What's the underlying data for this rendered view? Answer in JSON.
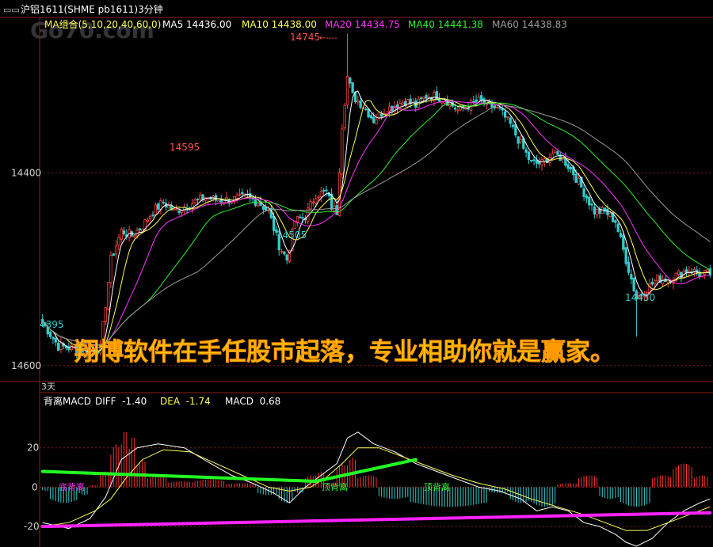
{
  "window": {
    "title": "沪铝1611(SHME pb1611)3分钟",
    "watermark": "Go70.com"
  },
  "colors": {
    "up": "#ff4040",
    "down": "#33cccc",
    "ma5": "#ffffff",
    "ma10": "#ffff55",
    "ma20": "#ff33ff",
    "ma40": "#33ee33",
    "ma60": "#9a9a9a",
    "grid": "#8a1c1c",
    "macd_pos": "#ff3030",
    "macd_neg": "#33cccc",
    "trend_green": "#22ff22",
    "trend_magenta": "#ff22ff",
    "banner": "#ffee00"
  },
  "ma_legend": {
    "group": "MA组合(5,10,20,40,60,0)",
    "ma5": "MA5 14436.00",
    "ma10": "MA10 14438.00",
    "ma20": "MA20 14434.75",
    "ma40": "MA40 14441.38",
    "ma60": "MA60 14438.83"
  },
  "price_axis": {
    "ticks": [
      "14600",
      "14400"
    ]
  },
  "annotations": {
    "high": "14745",
    "peak1": "14595",
    "low1": "14505",
    "low2": "14430",
    "low0": "4395",
    "day_label": "3天"
  },
  "banner": "翔博软件在手任股市起落，专业相助你就是赢家。",
  "macd_legend": {
    "name": "背离MACD",
    "diff": "DIFF  -1.40",
    "dea": "DEA  -1.74",
    "macd": "MACD  0.68"
  },
  "macd_axis": {
    "ticks": [
      "20",
      "0",
      "-20"
    ]
  },
  "macd_labels": {
    "bottom_div": "底背离",
    "top_div1": "顶背离",
    "top_div2": "顶背离"
  },
  "chart_data": [
    {
      "type": "candlestick",
      "title": "沪铝1611(SHME pb1611)3分钟",
      "ylim": [
        14385,
        14760
      ],
      "y_ticks": [
        14400,
        14600
      ],
      "close_path": [
        [
          0,
          14445
        ],
        [
          6,
          14420
        ],
        [
          12,
          14418
        ],
        [
          18,
          14415
        ],
        [
          22,
          14418
        ],
        [
          26,
          14510
        ],
        [
          30,
          14540
        ],
        [
          34,
          14535
        ],
        [
          38,
          14545
        ],
        [
          42,
          14560
        ],
        [
          46,
          14570
        ],
        [
          50,
          14560
        ],
        [
          54,
          14565
        ],
        [
          58,
          14570
        ],
        [
          62,
          14575
        ],
        [
          66,
          14572
        ],
        [
          70,
          14572
        ],
        [
          74,
          14573
        ],
        [
          78,
          14575
        ],
        [
          82,
          14570
        ],
        [
          86,
          14560
        ],
        [
          90,
          14525
        ],
        [
          93,
          14510
        ],
        [
          96,
          14550
        ],
        [
          100,
          14555
        ],
        [
          104,
          14578
        ],
        [
          108,
          14580
        ],
        [
          110,
          14565
        ],
        [
          112,
          14560
        ],
        [
          114,
          14650
        ],
        [
          116,
          14700
        ],
        [
          118,
          14680
        ],
        [
          122,
          14670
        ],
        [
          126,
          14655
        ],
        [
          130,
          14665
        ],
        [
          134,
          14670
        ],
        [
          138,
          14675
        ],
        [
          142,
          14670
        ],
        [
          146,
          14680
        ],
        [
          150,
          14680
        ],
        [
          154,
          14675
        ],
        [
          158,
          14665
        ],
        [
          162,
          14670
        ],
        [
          166,
          14675
        ],
        [
          170,
          14670
        ],
        [
          174,
          14665
        ],
        [
          178,
          14650
        ],
        [
          182,
          14630
        ],
        [
          186,
          14610
        ],
        [
          190,
          14610
        ],
        [
          194,
          14620
        ],
        [
          198,
          14615
        ],
        [
          202,
          14600
        ],
        [
          206,
          14580
        ],
        [
          210,
          14560
        ],
        [
          214,
          14560
        ],
        [
          218,
          14550
        ],
        [
          222,
          14510
        ],
        [
          226,
          14470
        ],
        [
          230,
          14480
        ],
        [
          234,
          14490
        ],
        [
          238,
          14490
        ],
        [
          242,
          14495
        ],
        [
          246,
          14500
        ],
        [
          250,
          14495
        ],
        [
          254,
          14495
        ]
      ],
      "ma_lines": [
        "MA5",
        "MA10",
        "MA20",
        "MA40",
        "MA60"
      ]
    },
    {
      "type": "bar",
      "title": "背离MACD",
      "ylim": [
        -30,
        40
      ],
      "y_ticks": [
        20,
        0,
        -20
      ],
      "histogram": [
        {
          "from": 0,
          "to": 3,
          "value": -2
        },
        {
          "from": 3,
          "to": 14,
          "value": -8
        },
        {
          "from": 14,
          "to": 18,
          "value": -4
        },
        {
          "from": 18,
          "to": 22,
          "value": 1
        },
        {
          "from": 22,
          "to": 26,
          "value": 8
        },
        {
          "from": 26,
          "to": 30,
          "value": 22
        },
        {
          "from": 30,
          "to": 33,
          "value": 29
        },
        {
          "from": 33,
          "to": 36,
          "value": 26
        },
        {
          "from": 36,
          "to": 40,
          "value": 14
        },
        {
          "from": 40,
          "to": 48,
          "value": 6
        },
        {
          "from": 48,
          "to": 58,
          "value": 3
        },
        {
          "from": 58,
          "to": 70,
          "value": 4
        },
        {
          "from": 70,
          "to": 82,
          "value": 2
        },
        {
          "from": 82,
          "to": 90,
          "value": -4
        },
        {
          "from": 90,
          "to": 96,
          "value": -8
        },
        {
          "from": 96,
          "to": 100,
          "value": -3
        },
        {
          "from": 100,
          "to": 104,
          "value": 6
        },
        {
          "from": 104,
          "to": 108,
          "value": 8
        },
        {
          "from": 108,
          "to": 112,
          "value": 2
        },
        {
          "from": 112,
          "to": 116,
          "value": 12
        },
        {
          "from": 116,
          "to": 120,
          "value": 15
        },
        {
          "from": 120,
          "to": 128,
          "value": 6
        },
        {
          "from": 128,
          "to": 140,
          "value": -6
        },
        {
          "from": 140,
          "to": 170,
          "value": -10
        },
        {
          "from": 170,
          "to": 178,
          "value": -3
        },
        {
          "from": 178,
          "to": 186,
          "value": -8
        },
        {
          "from": 186,
          "to": 196,
          "value": -10
        },
        {
          "from": 196,
          "to": 204,
          "value": 2
        },
        {
          "from": 204,
          "to": 212,
          "value": 6
        },
        {
          "from": 212,
          "to": 220,
          "value": -6
        },
        {
          "from": 220,
          "to": 232,
          "value": -10
        },
        {
          "from": 232,
          "to": 240,
          "value": 6
        },
        {
          "from": 240,
          "to": 248,
          "value": 12
        },
        {
          "from": 248,
          "to": 254,
          "value": 6
        }
      ],
      "diff_path": [
        [
          0,
          -18
        ],
        [
          10,
          -21
        ],
        [
          18,
          -16
        ],
        [
          24,
          -5
        ],
        [
          30,
          14
        ],
        [
          36,
          20
        ],
        [
          44,
          22
        ],
        [
          54,
          20
        ],
        [
          64,
          12
        ],
        [
          72,
          6
        ],
        [
          80,
          2
        ],
        [
          88,
          -3
        ],
        [
          94,
          -8
        ],
        [
          100,
          0
        ],
        [
          106,
          6
        ],
        [
          112,
          12
        ],
        [
          116,
          25
        ],
        [
          120,
          28
        ],
        [
          126,
          22
        ],
        [
          134,
          18
        ],
        [
          142,
          12
        ],
        [
          150,
          8
        ],
        [
          158,
          4
        ],
        [
          166,
          0
        ],
        [
          174,
          -2
        ],
        [
          182,
          -6
        ],
        [
          188,
          -12
        ],
        [
          194,
          -10
        ],
        [
          200,
          -12
        ],
        [
          206,
          -18
        ],
        [
          212,
          -20
        ],
        [
          218,
          -24
        ],
        [
          222,
          -28
        ],
        [
          226,
          -30
        ],
        [
          232,
          -26
        ],
        [
          238,
          -18
        ],
        [
          244,
          -12
        ],
        [
          250,
          -8
        ],
        [
          254,
          -6
        ]
      ],
      "dea_path": [
        [
          0,
          -20
        ],
        [
          10,
          -18
        ],
        [
          20,
          -12
        ],
        [
          26,
          -6
        ],
        [
          32,
          5
        ],
        [
          38,
          14
        ],
        [
          46,
          19
        ],
        [
          56,
          18
        ],
        [
          66,
          12
        ],
        [
          76,
          6
        ],
        [
          86,
          0
        ],
        [
          94,
          -2
        ],
        [
          102,
          0
        ],
        [
          108,
          5
        ],
        [
          114,
          12
        ],
        [
          120,
          20
        ],
        [
          128,
          20
        ],
        [
          136,
          16
        ],
        [
          146,
          11
        ],
        [
          156,
          6
        ],
        [
          166,
          2
        ],
        [
          176,
          -1
        ],
        [
          186,
          -6
        ],
        [
          196,
          -10
        ],
        [
          206,
          -14
        ],
        [
          214,
          -18
        ],
        [
          222,
          -22
        ],
        [
          230,
          -22
        ],
        [
          238,
          -18
        ],
        [
          246,
          -14
        ],
        [
          254,
          -10
        ]
      ],
      "trend_lines": [
        {
          "color": "green",
          "points": [
            [
              0,
              8
            ],
            [
              104,
              3
            ]
          ]
        },
        {
          "color": "green",
          "points": [
            [
              104,
              3
            ],
            [
              142,
              14
            ]
          ]
        },
        {
          "color": "magenta",
          "points": [
            [
              0,
              -20
            ],
            [
              254,
              -13
            ]
          ]
        }
      ]
    }
  ]
}
